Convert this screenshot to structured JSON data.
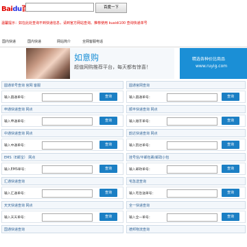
{
  "header": {
    "logo_text": "Bai",
    "logo_paw": "du",
    "logo_suffix": "百度",
    "search_button": "百度一下"
  },
  "notice": "温馨提示：如在此处查询不到快递信息，请到官方网站查询。推荐使用 kuaidi100 查询快递单号",
  "nav": {
    "items": [
      "国内快递",
      "国内快递",
      "网站简介",
      "全网客服电话"
    ]
  },
  "banner": {
    "title": "如意购",
    "subtitle": "超值网购推荐平台，每天都有惊喜！",
    "right_title": "精选各种价比商品",
    "right_url": "www.ruyig.com"
  },
  "sections": [
    {
      "title": "圆通单号查询 官网 客服",
      "label": "输入圆通单号：",
      "button": "查询"
    },
    {
      "title": "圆通官网查询",
      "label": "输入圆通单号：",
      "button": "查询"
    },
    {
      "title": "申通快递查询  网点",
      "label": "输入申通单号：",
      "button": "查询"
    },
    {
      "title": "顺丰快递查询  网点",
      "label": "输入顺丰单号：",
      "button": "查询"
    },
    {
      "title": "中通快递查询  网点",
      "label": "输入中通单号：",
      "button": "查询"
    },
    {
      "title": "韵达快递查询  网点",
      "label": "输入韵达单号：",
      "button": "查询"
    },
    {
      "title": "EMS（E邮宝） 网点",
      "label": "输入EMS单号：",
      "button": "查询"
    },
    {
      "title": "挂号信/平邮包裹/邮政小包",
      "label": "输入邮政单号：",
      "button": "查询"
    },
    {
      "title": "汇通快递查询",
      "label": "输入汇通单号：",
      "button": "查询"
    },
    {
      "title": "宅急送查询",
      "label": "输入宅急送单号：",
      "button": "查询"
    },
    {
      "title": "天天快递查询  网点",
      "label": "输入天天单号：",
      "button": "查询"
    },
    {
      "title": "全一快递查询",
      "label": "输入全一单号：",
      "button": "查询"
    },
    {
      "title": "国通快递查询",
      "label": "",
      "button": ""
    },
    {
      "title": "德邦物流查询",
      "label": "",
      "button": ""
    }
  ]
}
